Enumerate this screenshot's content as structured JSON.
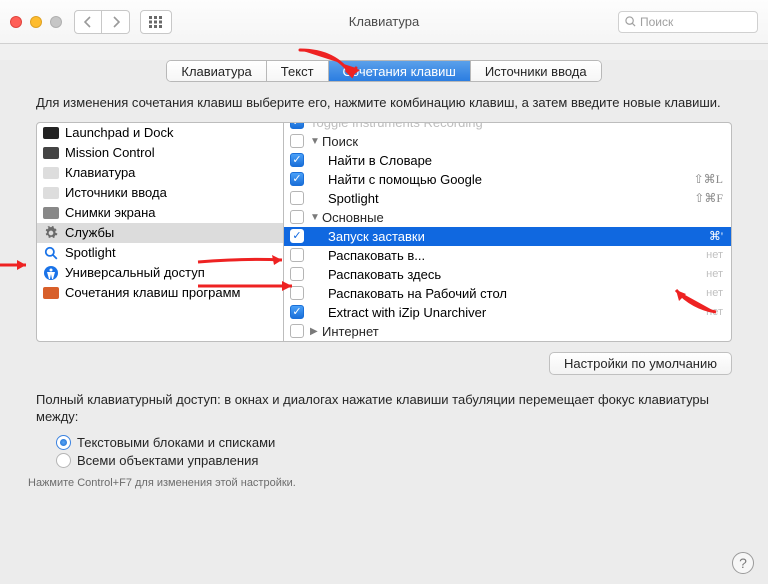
{
  "window": {
    "title": "Клавиатура"
  },
  "search": {
    "placeholder": "Поиск"
  },
  "tabs": [
    {
      "label": "Клавиатура",
      "active": false
    },
    {
      "label": "Текст",
      "active": false
    },
    {
      "label": "Сочетания клавиш",
      "active": true
    },
    {
      "label": "Источники ввода",
      "active": false
    }
  ],
  "instructions": "Для изменения сочетания клавиш выберите его, нажмите комбинацию клавиш, а затем введите новые клавиши.",
  "categories": [
    {
      "label": "Launchpad и Dock",
      "icon": "launchpad",
      "color": "#222"
    },
    {
      "label": "Mission Control",
      "icon": "mission",
      "color": "#444"
    },
    {
      "label": "Клавиатура",
      "icon": "keyboard",
      "color": "#ddd"
    },
    {
      "label": "Источники ввода",
      "icon": "input",
      "color": "#ddd"
    },
    {
      "label": "Снимки экрана",
      "icon": "screenshot",
      "color": "#888"
    },
    {
      "label": "Службы",
      "icon": "gear",
      "selected": true
    },
    {
      "label": "Spotlight",
      "icon": "spotlight",
      "color": "#1a73e8"
    },
    {
      "label": "Универсальный доступ",
      "icon": "accessibility",
      "color": "#1a73e8"
    },
    {
      "label": "Сочетания клавиш программ",
      "icon": "app",
      "color": "#d85f2a"
    }
  ],
  "services": [
    {
      "type": "item",
      "checked": true,
      "label": "Toggle Instruments Recording",
      "shortcut": "",
      "cut": true
    },
    {
      "type": "group",
      "checked": false,
      "label": "Поиск",
      "expanded": true
    },
    {
      "type": "item",
      "checked": true,
      "indent": 1,
      "label": "Найти в Словаре",
      "shortcut": ""
    },
    {
      "type": "item",
      "checked": true,
      "indent": 1,
      "label": "Найти с помощью Google",
      "shortcut": "⇧⌘L"
    },
    {
      "type": "item",
      "checked": false,
      "indent": 1,
      "label": "Spotlight",
      "shortcut": "⇧⌘F"
    },
    {
      "type": "group",
      "checked": false,
      "label": "Основные",
      "expanded": true
    },
    {
      "type": "item",
      "checked": true,
      "indent": 1,
      "label": "Запуск заставки",
      "shortcut": "⌘'",
      "selected": true
    },
    {
      "type": "item",
      "checked": false,
      "indent": 1,
      "label": "Распаковать в...",
      "none": true
    },
    {
      "type": "item",
      "checked": false,
      "indent": 1,
      "label": "Распаковать здесь",
      "none": true
    },
    {
      "type": "item",
      "checked": false,
      "indent": 1,
      "label": "Распаковать на Рабочий стол",
      "none": true
    },
    {
      "type": "item",
      "checked": true,
      "indent": 1,
      "label": "Extract with iZip Unarchiver",
      "none": true
    },
    {
      "type": "group",
      "checked": false,
      "label": "Интернет",
      "expanded": false
    }
  ],
  "defaults_button": "Настройки по умолчанию",
  "full_access_text": "Полный клавиатурный доступ: в окнах и диалогах нажатие клавиши табуляции перемещает фокус клавиатуры между:",
  "radios": [
    {
      "label": "Текстовыми блоками и списками",
      "checked": true
    },
    {
      "label": "Всеми объектами управления",
      "checked": false
    }
  ],
  "hint": "Нажмите Control+F7 для изменения этой настройки."
}
